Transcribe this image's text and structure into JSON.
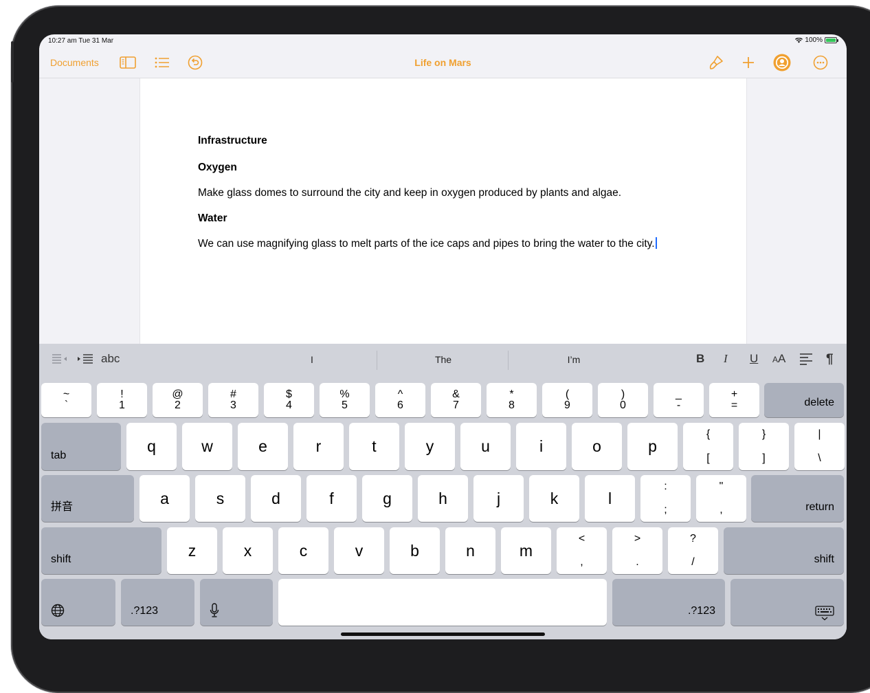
{
  "status": {
    "time": "10:27 am  Tue 31 Mar",
    "battery": "100%"
  },
  "nav": {
    "documents": "Documents",
    "title": "Life on Mars"
  },
  "colors": {
    "accent": "#f0a030",
    "cursor": "#1e6bff"
  },
  "icons": [
    "sidebar-icon",
    "list-icon",
    "undo-icon",
    "paintbrush-icon",
    "plus-icon",
    "collaborate-icon",
    "more-icon"
  ],
  "document": {
    "p1": "Infrastructure",
    "p2": "Oxygen",
    "p3": "Make glass domes to surround the city and keep in oxygen produced by plants and algae.",
    "p4": "Water",
    "p5": "We can use magnifying glass to melt parts of the ice caps and pipes to bring the water to the city."
  },
  "toolbar": {
    "abc": "abc",
    "suggestions": [
      "I",
      "The",
      "I’m"
    ],
    "bold": "B",
    "italic": "I",
    "underline": "U",
    "size": "AA",
    "pilcrow": "¶"
  },
  "keys": {
    "row1": [
      {
        "top": "~",
        "bot": "`"
      },
      {
        "top": "!",
        "bot": "1"
      },
      {
        "top": "@",
        "bot": "2"
      },
      {
        "top": "#",
        "bot": "3"
      },
      {
        "top": "$",
        "bot": "4"
      },
      {
        "top": "%",
        "bot": "5"
      },
      {
        "top": "^",
        "bot": "6"
      },
      {
        "top": "&",
        "bot": "7"
      },
      {
        "top": "*",
        "bot": "8"
      },
      {
        "top": "(",
        "bot": "9"
      },
      {
        "top": ")",
        "bot": "0"
      },
      {
        "top": "_",
        "bot": "-"
      },
      {
        "top": "+",
        "bot": "="
      }
    ],
    "delete": "delete",
    "tab": "tab",
    "row2": [
      "q",
      "w",
      "e",
      "r",
      "t",
      "y",
      "u",
      "i",
      "o",
      "p"
    ],
    "row2_sym": [
      {
        "top": "{",
        "bot": "["
      },
      {
        "top": "}",
        "bot": "]"
      },
      {
        "top": "|",
        "bot": "\\"
      }
    ],
    "pinyin": "拼音",
    "row3": [
      "a",
      "s",
      "d",
      "f",
      "g",
      "h",
      "j",
      "k",
      "l"
    ],
    "row3_sym": [
      {
        "top": ":",
        "bot": ";"
      },
      {
        "top": "\"",
        "bot": ","
      }
    ],
    "return": "return",
    "shift": "shift",
    "row4": [
      "z",
      "x",
      "c",
      "v",
      "b",
      "n",
      "m"
    ],
    "row4_sym": [
      {
        "top": "<",
        "bot": ","
      },
      {
        "top": ">",
        "bot": "."
      },
      {
        "top": "?",
        "bot": "/"
      }
    ],
    "num_left": ".?123",
    "num_right": ".?123"
  }
}
